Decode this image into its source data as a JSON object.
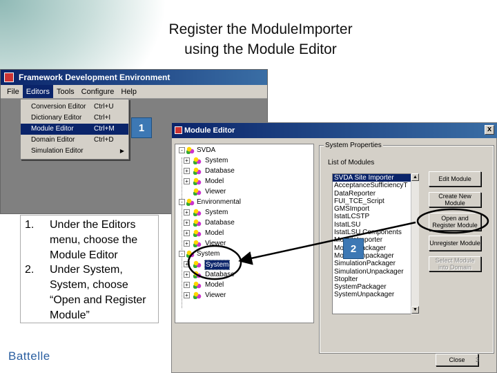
{
  "slide": {
    "title_line1": "Register the ModuleImporter",
    "title_line2": "using the Module Editor",
    "logo": "Battelle"
  },
  "fde_window": {
    "title": "Framework Development Environment",
    "menus": [
      "File",
      "Editors",
      "Tools",
      "Configure",
      "Help"
    ],
    "active_menu": "Editors",
    "editors_menu": [
      {
        "label": "Conversion Editor",
        "shortcut": "Ctrl+U"
      },
      {
        "label": "Dictionary Editor",
        "shortcut": "Ctrl+I"
      },
      {
        "label": "Module Editor",
        "shortcut": "Ctrl+M"
      },
      {
        "label": "Domain Editor",
        "shortcut": "Ctrl+D"
      },
      {
        "label": "Simulation Editor",
        "shortcut": "",
        "submenu_arrow": "▶"
      }
    ],
    "selected_item": "Module Editor"
  },
  "callouts": {
    "one": "1",
    "two": "2"
  },
  "instructions": [
    {
      "num": "1.",
      "text": "Under the Editors menu, choose the Module Editor"
    },
    {
      "num": "2.",
      "text": "Under System, System, choose “Open and Register Module”"
    }
  ],
  "module_editor": {
    "title": "Module Editor",
    "close_glyph": "x",
    "tree": [
      {
        "label": "SVDA",
        "level": 0,
        "expander": "-"
      },
      {
        "label": "System",
        "level": 1,
        "expander": "+"
      },
      {
        "label": "Database",
        "level": 1,
        "expander": "+"
      },
      {
        "label": "Model",
        "level": 1,
        "expander": "+"
      },
      {
        "label": "Viewer",
        "level": 1,
        "expander": ""
      },
      {
        "label": "Environmental",
        "level": 0,
        "expander": "-"
      },
      {
        "label": "System",
        "level": 1,
        "expander": "+"
      },
      {
        "label": "Database",
        "level": 1,
        "expander": "+"
      },
      {
        "label": "Model",
        "level": 1,
        "expander": "+"
      },
      {
        "label": "Viewer",
        "level": 1,
        "expander": "+"
      },
      {
        "label": "System",
        "level": 0,
        "expander": "-"
      },
      {
        "label": "System",
        "level": 1,
        "expander": "+",
        "selected": true
      },
      {
        "label": "Database",
        "level": 1,
        "expander": "+"
      },
      {
        "label": "Model",
        "level": 1,
        "expander": "+"
      },
      {
        "label": "Viewer",
        "level": 1,
        "expander": "+"
      }
    ],
    "group_title": "System Properties",
    "list_title": "List of Modules",
    "modules": [
      "SVDA Site Importer",
      "AcceptanceSufficiencyT",
      "DataReporter",
      "FUI_TCE_Script",
      "GMSImport",
      "IstatLCSTP",
      "IstatLSU",
      "IstatLSU Components",
      "ModuleImporter",
      "ModulePackager",
      "ModuleUnpackager",
      "SimulationPackager",
      "SimulationUnpackager",
      "Stoplter",
      "SystemPackager",
      "SystemUnpackager"
    ],
    "selected_module": "SVDA Site Importer",
    "scroll_up": "▲",
    "scroll_down": "▼",
    "buttons": {
      "edit_module": "Edit Module",
      "create_new_module": "Create New Module",
      "open_register": "Open and Register Module",
      "unregister": "Unregister Module",
      "select_domain": "Select Module into Domain",
      "close": "Close"
    },
    "page_stamp": "3"
  }
}
